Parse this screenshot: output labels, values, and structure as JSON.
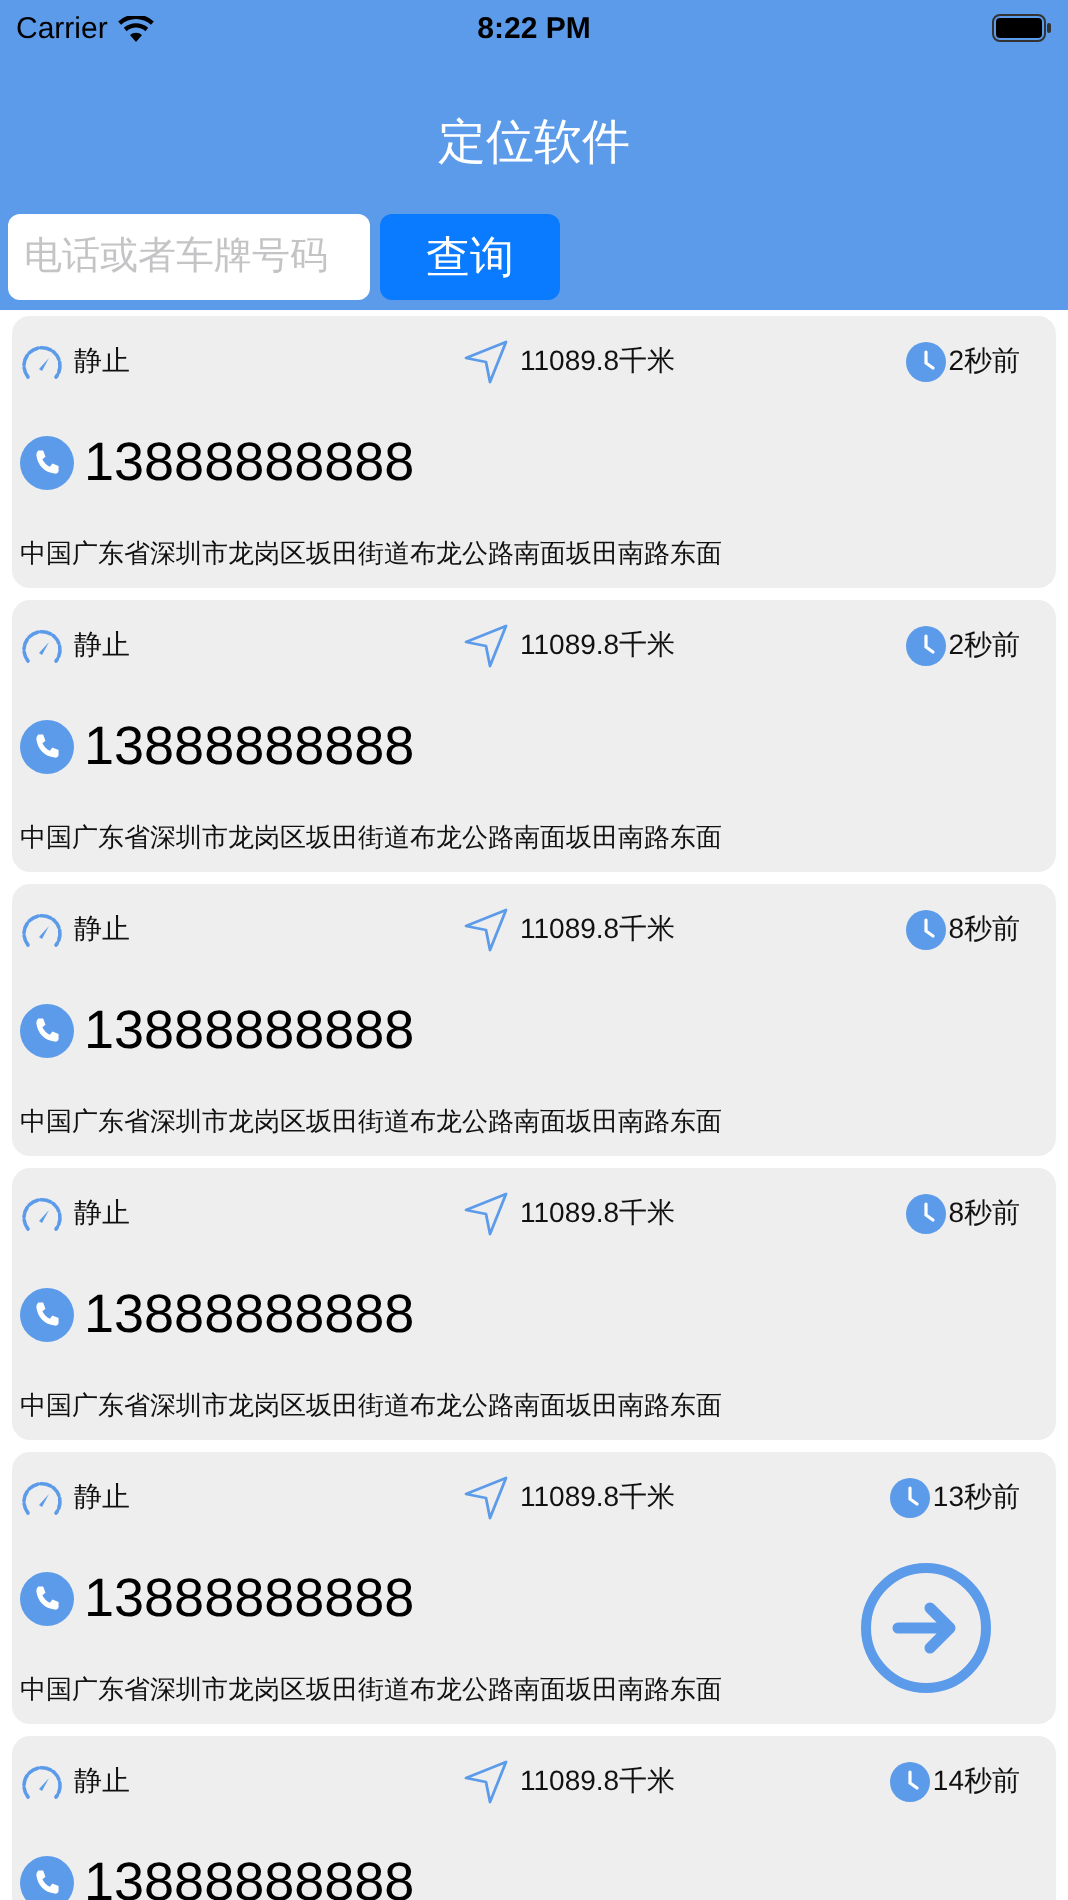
{
  "status_bar": {
    "carrier": "Carrier",
    "time": "8:22 PM"
  },
  "header": {
    "title": "定位软件"
  },
  "search": {
    "placeholder": "电话或者车牌号码",
    "button": "查询"
  },
  "records": [
    {
      "state": "静止",
      "distance": "11089.8千米",
      "time_ago": "2秒前",
      "phone": "13888888888",
      "address": "中国广东省深圳市龙岗区坂田街道布龙公路南面坂田南路东面"
    },
    {
      "state": "静止",
      "distance": "11089.8千米",
      "time_ago": "2秒前",
      "phone": "13888888888",
      "address": "中国广东省深圳市龙岗区坂田街道布龙公路南面坂田南路东面"
    },
    {
      "state": "静止",
      "distance": "11089.8千米",
      "time_ago": "8秒前",
      "phone": "13888888888",
      "address": "中国广东省深圳市龙岗区坂田街道布龙公路南面坂田南路东面"
    },
    {
      "state": "静止",
      "distance": "11089.8千米",
      "time_ago": "8秒前",
      "phone": "13888888888",
      "address": "中国广东省深圳市龙岗区坂田街道布龙公路南面坂田南路东面"
    },
    {
      "state": "静止",
      "distance": "11089.8千米",
      "time_ago": "13秒前",
      "phone": "13888888888",
      "address": "中国广东省深圳市龙岗区坂田街道布龙公路南面坂田南路东面"
    },
    {
      "state": "静止",
      "distance": "11089.8千米",
      "time_ago": "14秒前",
      "phone": "13888888888"
    }
  ]
}
